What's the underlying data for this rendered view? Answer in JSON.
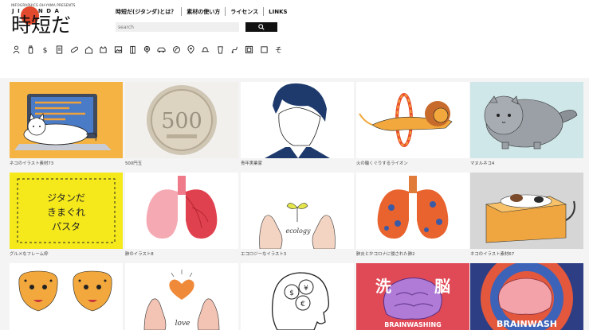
{
  "logo": {
    "tagline": "INFOGRAPHICS OH-YAMA PRESENTS",
    "letters": "JITANDA",
    "wordmark": "時短だ"
  },
  "nav": [
    {
      "label": "時短だ(ジタンダ)とは？"
    },
    {
      "label": "素材の使い方"
    },
    {
      "label": "ライセンス"
    },
    {
      "label": "LINKS"
    }
  ],
  "search": {
    "placeholder": "search"
  },
  "category_icons": [
    "person-icon",
    "bottle-icon",
    "dollar-icon",
    "document-icon",
    "pill-icon",
    "house-icon",
    "cat-icon",
    "picture-icon",
    "building-icon",
    "medal-icon",
    "car-icon",
    "leaf-icon",
    "map-pin-icon",
    "hat-icon",
    "cup-icon",
    "route-icon",
    "frame-icon",
    "square-icon",
    "other-icon"
  ],
  "items": [
    {
      "caption": "ネコのイラスト素材73"
    },
    {
      "caption": "500円玉"
    },
    {
      "caption": "青年実業家"
    },
    {
      "caption": "火の輪くぐりするライオン"
    },
    {
      "caption": "マヌルネコ4"
    },
    {
      "caption": "グルメなフレーム枠"
    },
    {
      "caption": "肺のイラスト8"
    },
    {
      "caption": "エコロジーなイラスト3"
    },
    {
      "caption": "肺炎とかコロナに侵された肺2"
    },
    {
      "caption": "ネコのイラスト素材67"
    },
    {
      "caption": ""
    },
    {
      "caption": ""
    },
    {
      "caption": ""
    },
    {
      "caption": ""
    },
    {
      "caption": ""
    }
  ],
  "art_text": {
    "coin": "500",
    "eco_word": "ecology",
    "frame_text": "ジタンだ きまぐれ バスタ",
    "love_word": "love",
    "brain_jp_left": "洗",
    "brain_jp_right": "脳",
    "brain_en_1": "BRAINWASHING",
    "brain_en_2": "BRAINWASH"
  },
  "colors": {
    "accent": "#e2492d",
    "black": "#111111"
  }
}
